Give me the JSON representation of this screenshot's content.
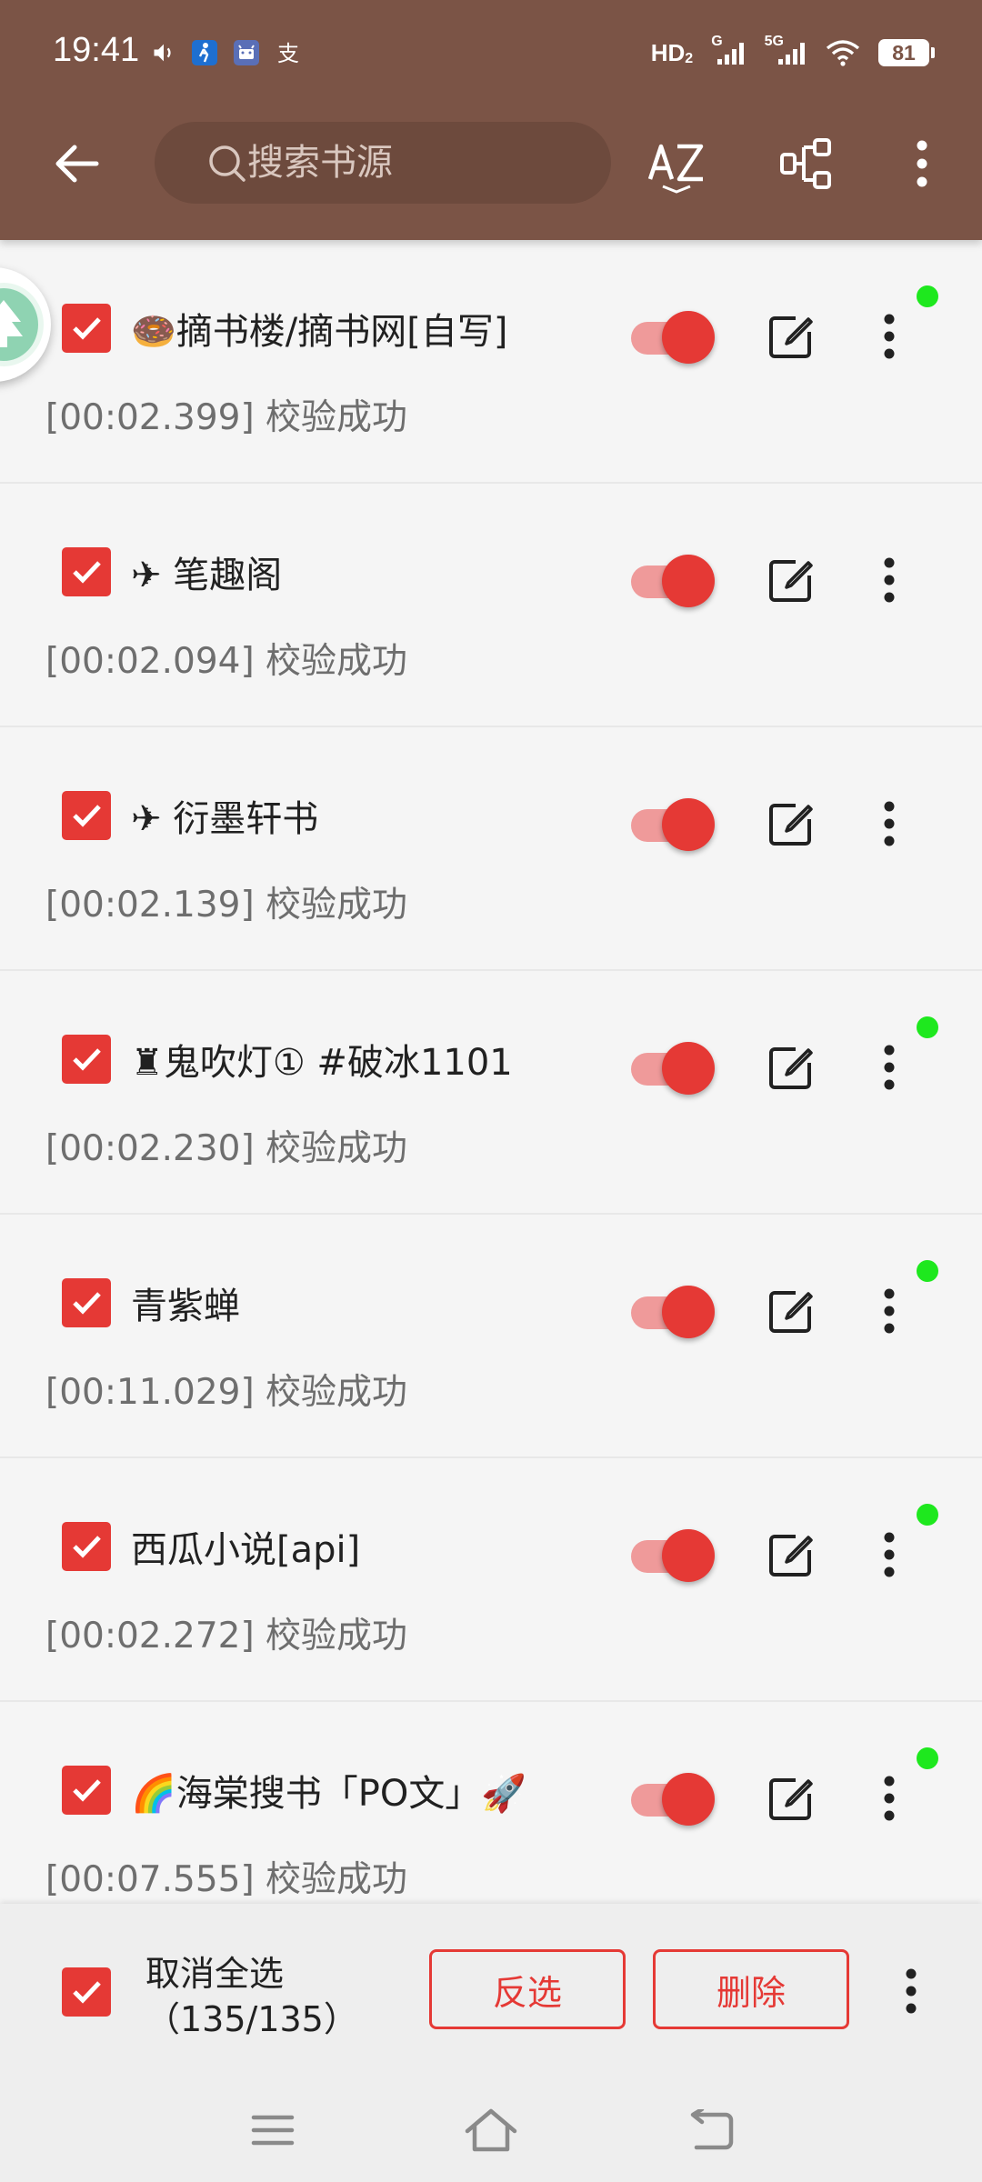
{
  "status_bar": {
    "time": "19:41",
    "left_icons": [
      "volume-icon",
      "pedometer-app-icon",
      "android-app-icon",
      "alipay-icon"
    ],
    "hd_label": "HD",
    "hd_sub": "2",
    "network_1": "G",
    "network_2": "5G",
    "battery": "81"
  },
  "toolbar": {
    "search_placeholder": "搜索书源",
    "sort_icon": "sort-az-icon",
    "group_icon": "group-icon"
  },
  "sources": [
    {
      "name": "🍩摘书楼/摘书网[自写]",
      "status": "[00:02.399] 校验成功",
      "checked": true,
      "enabled": true,
      "dot": true
    },
    {
      "name": "✈ 笔趣阁",
      "status": "[00:02.094] 校验成功",
      "checked": true,
      "enabled": true,
      "dot": false
    },
    {
      "name": "✈ 衍墨轩书",
      "status": "[00:02.139] 校验成功",
      "checked": true,
      "enabled": true,
      "dot": false
    },
    {
      "name": "♜鬼吹灯① #破冰1101",
      "status": "[00:02.230] 校验成功",
      "checked": true,
      "enabled": true,
      "dot": true
    },
    {
      "name": "青紫蝉",
      "status": "[00:11.029] 校验成功",
      "checked": true,
      "enabled": true,
      "dot": true
    },
    {
      "name": "西瓜小说[api]",
      "status": "[00:02.272] 校验成功",
      "checked": true,
      "enabled": true,
      "dot": true
    },
    {
      "name": "🌈海棠搜书「PO文」🚀",
      "status": "[00:07.555] 校验成功",
      "checked": true,
      "enabled": true,
      "dot": true
    }
  ],
  "bottom_bar": {
    "select_label": "取消全选",
    "count_label": "（135/135）",
    "invert_label": "反选",
    "delete_label": "删除"
  },
  "colors": {
    "header": "#7b5446",
    "accent": "#e53935",
    "online_dot": "#1ee81e"
  }
}
